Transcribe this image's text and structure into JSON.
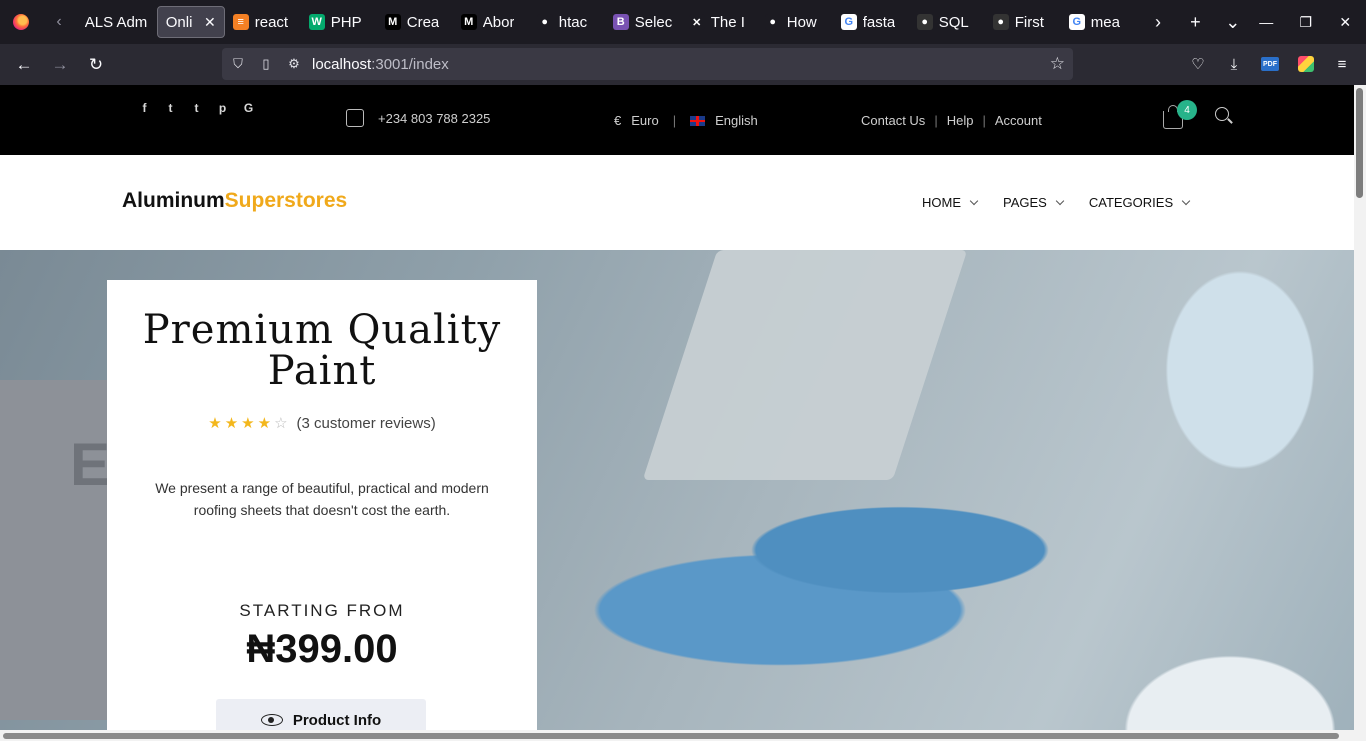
{
  "browser": {
    "tabs": [
      {
        "title": "ALS Adm",
        "icon": "blank",
        "color": "#1c1b22",
        "glyph": ""
      },
      {
        "title": "Online",
        "icon": "blank",
        "color": "#1c1b22",
        "glyph": "",
        "active": true
      },
      {
        "title": "react",
        "icon": "stackoverflow-icon",
        "color": "#f48024",
        "glyph": "≡"
      },
      {
        "title": "PHP",
        "icon": "w3schools-icon",
        "color": "#04aa6d",
        "glyph": "W"
      },
      {
        "title": "Crea",
        "icon": "medium-icon",
        "color": "#000000",
        "glyph": "M"
      },
      {
        "title": "Abor",
        "icon": "medium-icon",
        "color": "#000000",
        "glyph": "M"
      },
      {
        "title": "htac",
        "icon": "github-icon",
        "color": "#1c1b22",
        "glyph": "●"
      },
      {
        "title": "Selec",
        "icon": "bootstrap-icon",
        "color": "#7952b3",
        "glyph": "B"
      },
      {
        "title": "The I",
        "icon": "figure-icon",
        "color": "#1c1b22",
        "glyph": "✕"
      },
      {
        "title": "How",
        "icon": "github-icon",
        "color": "#1c1b22",
        "glyph": "●"
      },
      {
        "title": "fasta",
        "icon": "google-icon",
        "color": "#ffffff",
        "glyph": "G"
      },
      {
        "title": "SQL",
        "icon": "dark-circle-icon",
        "color": "#333333",
        "glyph": "●"
      },
      {
        "title": "First",
        "icon": "dark-circle-icon",
        "color": "#333333",
        "glyph": "●"
      },
      {
        "title": "mea",
        "icon": "google-icon",
        "color": "#ffffff",
        "glyph": "G"
      }
    ],
    "url_host": "localhost",
    "url_path": ":3001/index"
  },
  "topbar": {
    "social": [
      "f",
      "t",
      "t",
      "p",
      "G"
    ],
    "phone": "+234 803 788 2325",
    "currency_symbol": "€",
    "currency": "Euro",
    "language": "English",
    "links": [
      "Contact Us",
      "Help",
      "Account"
    ],
    "cart_count": "4"
  },
  "header": {
    "logo_main": "Aluminum",
    "logo_accent": "Superstores",
    "menu": [
      "HOME",
      "PAGES",
      "CATEGORIES"
    ]
  },
  "hero": {
    "title": "Premium Quality Paint",
    "rating": 4,
    "rating_max": 5,
    "reviews": "(3 customer reviews)",
    "description": "We present a range of beautiful, practical and modern roofing sheets that doesn't cost the earth.",
    "starting_from": "STARTING FROM",
    "price": "₦399.00",
    "button": "Product Info"
  },
  "colors": {
    "accent": "#f0a91b",
    "badge": "#27b38a"
  }
}
